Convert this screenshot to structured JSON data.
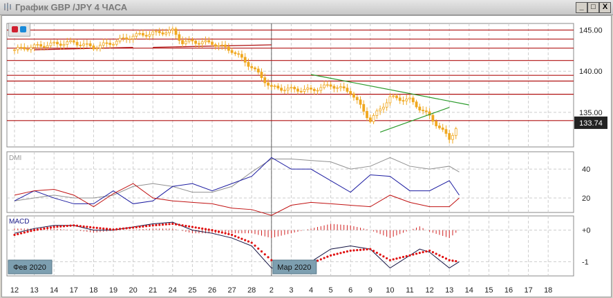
{
  "window": {
    "title": "График GBP /JPY  4 ЧАСА",
    "min": "_",
    "max": "□",
    "close": "X"
  },
  "colors": {
    "candle": "#f0a820",
    "level": "#b01010",
    "trend": "#2a9a2a",
    "plus_di": "#1a1aa0",
    "minus_di": "#c01010",
    "adx": "#909090",
    "macd": "#101040",
    "signal": "#e01010",
    "hist": "#d02020"
  },
  "chart_data": {
    "type": "candlestick",
    "x_labels": [
      "12",
      "13",
      "14",
      "17",
      "18",
      "19",
      "20",
      "21",
      "24",
      "25",
      "26",
      "27",
      "28",
      "2",
      "3",
      "4",
      "5",
      "6",
      "9",
      "10",
      "11",
      "12",
      "13",
      "14",
      "15",
      "16",
      "17",
      "18"
    ],
    "month_labels": [
      {
        "label": "Фев 2020",
        "index": 0
      },
      {
        "label": "Мар 2020",
        "index": 13
      }
    ],
    "price": {
      "ylim": [
        130.8,
        145.8
      ],
      "ticks": [
        "145.00",
        "140.00",
        "135.00"
      ],
      "tick_values": [
        145,
        140,
        135
      ],
      "last_price": "133.74",
      "last_value": 133.74,
      "close_index": [
        0,
        1,
        2,
        3,
        4,
        5,
        6,
        7,
        8,
        8.5,
        9,
        10,
        11,
        12,
        13,
        14,
        15,
        16,
        17,
        18,
        19,
        20,
        21,
        22,
        22.5
      ],
      "close": [
        142.6,
        143.0,
        143.3,
        143.5,
        142.9,
        143.5,
        144.3,
        144.6,
        144.9,
        143.5,
        143.6,
        143.4,
        142.5,
        140.5,
        138.0,
        137.8,
        137.7,
        138.3,
        137.5,
        134.0,
        136.8,
        136.5,
        134.5,
        131.8,
        133.74
      ],
      "levels": [
        145.0,
        143.9,
        142.8,
        141.3,
        139.5,
        138.8,
        137.2,
        134.0
      ],
      "support_lines": [
        {
          "from": [
            1,
            142.6
          ],
          "to": [
            6,
            142.9
          ]
        },
        {
          "from": [
            7,
            142.9
          ],
          "to": [
            13,
            143.2
          ]
        }
      ],
      "trend_lines": [
        {
          "from": [
            15,
            139.6
          ],
          "to": [
            23,
            135.9
          ]
        },
        {
          "from": [
            18.5,
            132.6
          ],
          "to": [
            22,
            135.6
          ]
        }
      ]
    },
    "dmi": {
      "title": "DMI",
      "ylim": [
        10,
        52
      ],
      "ticks": [
        "40",
        "20"
      ],
      "tick_values": [
        40,
        20
      ],
      "index": [
        0,
        1,
        2,
        3,
        4,
        5,
        6,
        7,
        8,
        9,
        10,
        11,
        12,
        13,
        14,
        15,
        16,
        17,
        18,
        19,
        20,
        21,
        22,
        22.5
      ],
      "adx": [
        18,
        20,
        22,
        20,
        20,
        22,
        28,
        30,
        28,
        24,
        24,
        28,
        38,
        47,
        47,
        46,
        45,
        40,
        42,
        48,
        42,
        40,
        42,
        38
      ],
      "plus_di": [
        18,
        25,
        20,
        16,
        16,
        25,
        16,
        18,
        28,
        30,
        25,
        30,
        35,
        48,
        40,
        40,
        32,
        24,
        36,
        35,
        25,
        25,
        32,
        22
      ],
      "minus_di": [
        22,
        25,
        26,
        22,
        14,
        23,
        30,
        20,
        18,
        17,
        16,
        13,
        12,
        8,
        15,
        17,
        16,
        15,
        14,
        22,
        17,
        14,
        14,
        20
      ]
    },
    "macd": {
      "title": "MACD",
      "ylim": [
        -1.45,
        0.45
      ],
      "ticks": [
        "+0",
        "-1"
      ],
      "tick_values": [
        0,
        -1
      ],
      "index": [
        0,
        1,
        2,
        3,
        4,
        5,
        6,
        7,
        8,
        9,
        10,
        11,
        12,
        13,
        14,
        15,
        16,
        17,
        18,
        19,
        20,
        20.5,
        21,
        22,
        22.5
      ],
      "macd": [
        -0.1,
        0.05,
        0.15,
        0.15,
        0.0,
        0.0,
        0.1,
        0.2,
        0.25,
        0.0,
        -0.1,
        -0.25,
        -0.5,
        -1.2,
        -1.2,
        -1.0,
        -0.6,
        -0.5,
        -0.6,
        -1.2,
        -0.8,
        -0.6,
        -0.7,
        -1.2,
        -1.0
      ],
      "signal": [
        -0.15,
        0.0,
        0.1,
        0.15,
        0.08,
        0.02,
        0.08,
        0.15,
        0.2,
        0.1,
        0.0,
        -0.15,
        -0.4,
        -0.95,
        -1.1,
        -1.05,
        -0.8,
        -0.65,
        -0.6,
        -0.95,
        -0.8,
        -0.72,
        -0.65,
        -0.95,
        -1.0
      ]
    }
  }
}
